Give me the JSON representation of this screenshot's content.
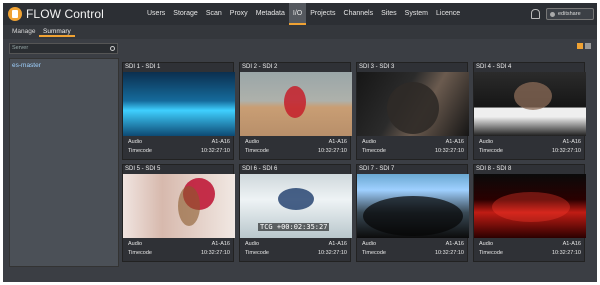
{
  "app": {
    "title": "FLOW Control"
  },
  "nav": [
    {
      "label": "Users"
    },
    {
      "label": "Storage"
    },
    {
      "label": "Scan"
    },
    {
      "label": "Proxy"
    },
    {
      "label": "Metadata"
    },
    {
      "label": "I/O",
      "active": true
    },
    {
      "label": "Projects"
    },
    {
      "label": "Channels"
    },
    {
      "label": "Sites"
    },
    {
      "label": "System"
    },
    {
      "label": "Licence"
    }
  ],
  "user": {
    "label": "editshare"
  },
  "tabs": [
    {
      "label": "Manage"
    },
    {
      "label": "Summary",
      "active": true
    }
  ],
  "search": {
    "placeholder": "Server"
  },
  "sidebar": {
    "items": [
      {
        "label": "es-master"
      }
    ]
  },
  "cards": [
    {
      "title": "SDI 1 - SDI 1",
      "audio_label": "Audio",
      "audio_value": "A1-A16",
      "timecode_label": "Timecode",
      "timecode_value": "10:32:27:10"
    },
    {
      "title": "SDI 2 - SDI 2",
      "audio_label": "Audio",
      "audio_value": "A1-A16",
      "timecode_label": "Timecode",
      "timecode_value": "10:32:27:10"
    },
    {
      "title": "SDI 3 - SDI 3",
      "audio_label": "Audio",
      "audio_value": "A1-A16",
      "timecode_label": "Timecode",
      "timecode_value": "10:32:27:10"
    },
    {
      "title": "SDI 4 - SDI 4",
      "audio_label": "Audio",
      "audio_value": "A1-A16",
      "timecode_label": "Timecode",
      "timecode_value": "10:32:27:10"
    },
    {
      "title": "SDI 5 - SDI 5",
      "audio_label": "Audio",
      "audio_value": "A1-A16",
      "timecode_label": "Timecode",
      "timecode_value": "10:32:27:10"
    },
    {
      "title": "SDI 6 - SDI 6",
      "audio_label": "Audio",
      "audio_value": "A1-A16",
      "timecode_label": "Timecode",
      "timecode_value": "10:32:27:10",
      "overlay": "TCG +00:02:35:27"
    },
    {
      "title": "SDI 7 - SDI 7",
      "audio_label": "Audio",
      "audio_value": "A1-A16",
      "timecode_label": "Timecode",
      "timecode_value": "10:32:27:10"
    },
    {
      "title": "SDI 8 - SDI 8",
      "audio_label": "Audio",
      "audio_value": "A1-A16",
      "timecode_label": "Timecode",
      "timecode_value": "10:32:27:10"
    }
  ],
  "icons": {
    "logo": "flow-logo-icon",
    "notifications": "bell-icon",
    "user": "user-icon",
    "search": "search-icon",
    "grid_view": "grid-view-icon",
    "list_view": "list-view-icon"
  },
  "colors": {
    "accent": "#f0a233",
    "topbar": "#2c2f34",
    "background": "#3b3e44"
  }
}
